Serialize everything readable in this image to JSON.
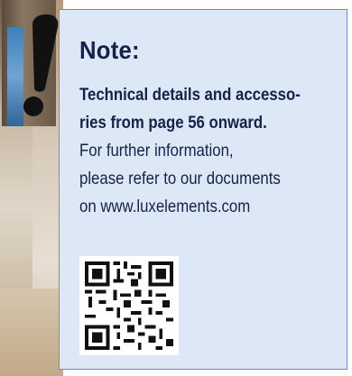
{
  "note": {
    "title": "Note:",
    "bold_lines": [
      "Technical details and accesso-",
      "ries from page 56 onward."
    ],
    "lines": [
      "For further information,",
      "please refer to our documents",
      "on www.luxelements.com"
    ]
  },
  "icons": {
    "exclamation": "exclamation-mark-icon",
    "qr": "qr-code-icon"
  },
  "colors": {
    "box_background": "#dde8f6",
    "box_border": "#6b8fc4",
    "text": "#12224a"
  }
}
